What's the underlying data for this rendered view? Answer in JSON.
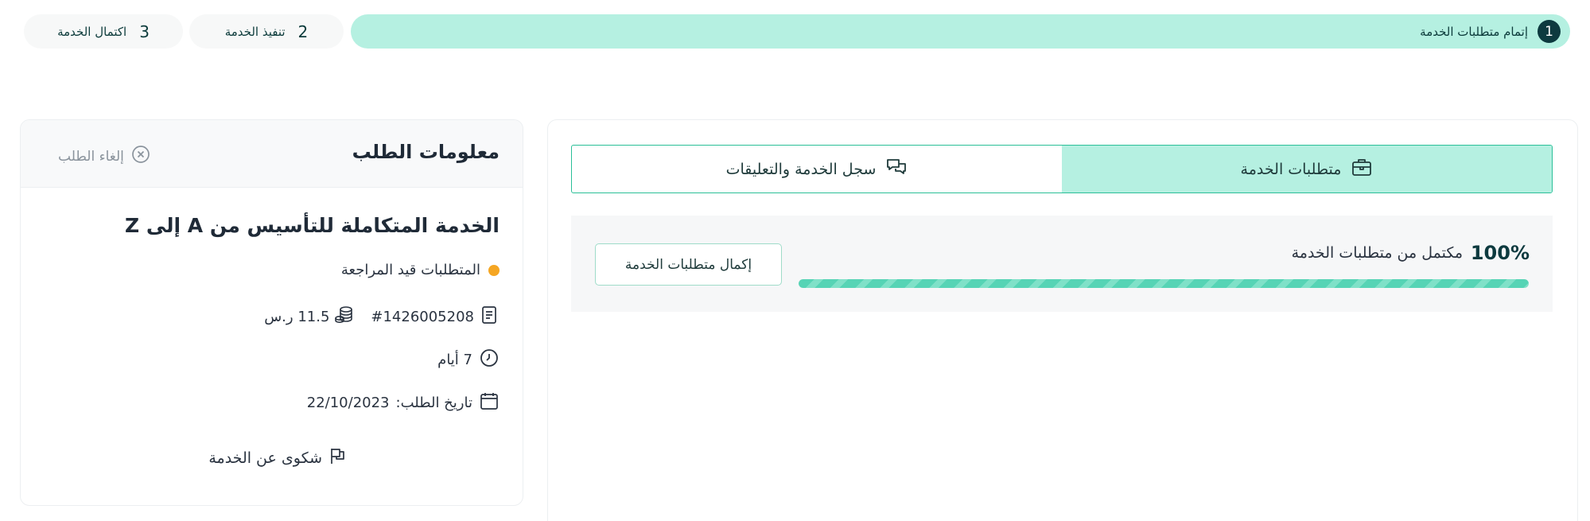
{
  "stepper": {
    "steps": [
      {
        "number": "1",
        "label": "إتمام متطلبات الخدمة",
        "state": "active"
      },
      {
        "number": "2",
        "label": "تنفيذ الخدمة",
        "state": "pending"
      },
      {
        "number": "3",
        "label": "اكتمال الخدمة",
        "state": "pending"
      }
    ]
  },
  "tabs": [
    {
      "label": "سجل الخدمة والتعليقات",
      "icon": "chat-bubbles-icon",
      "active": false
    },
    {
      "label": "متطلبات الخدمة",
      "icon": "briefcase-icon",
      "active": true
    }
  ],
  "requirements": {
    "percent_label": "100%",
    "progress_fraction": 1.0,
    "progress_text": "مكتمل من متطلبات الخدمة",
    "complete_button": "إكمال متطلبات الخدمة"
  },
  "order_info": {
    "title": "معلومات الطلب",
    "cancel_label": "إلغاء الطلب",
    "service_name": "الخدمة المتكاملة للتأسيس من A إلى Z",
    "status": "المتطلبات قيد المراجعة",
    "order_number": "#1426005208",
    "price": "11.5 ر.س",
    "duration": "7 أيام",
    "date_label": "تاريخ الطلب:",
    "date_value": "22/10/2023",
    "complaint_label": "شكوى عن الخدمة"
  },
  "colors": {
    "accent": "#b5f0e1",
    "accent_border": "#2bbf98",
    "dark": "#0d3a3f",
    "status_dot": "#f5a623"
  }
}
